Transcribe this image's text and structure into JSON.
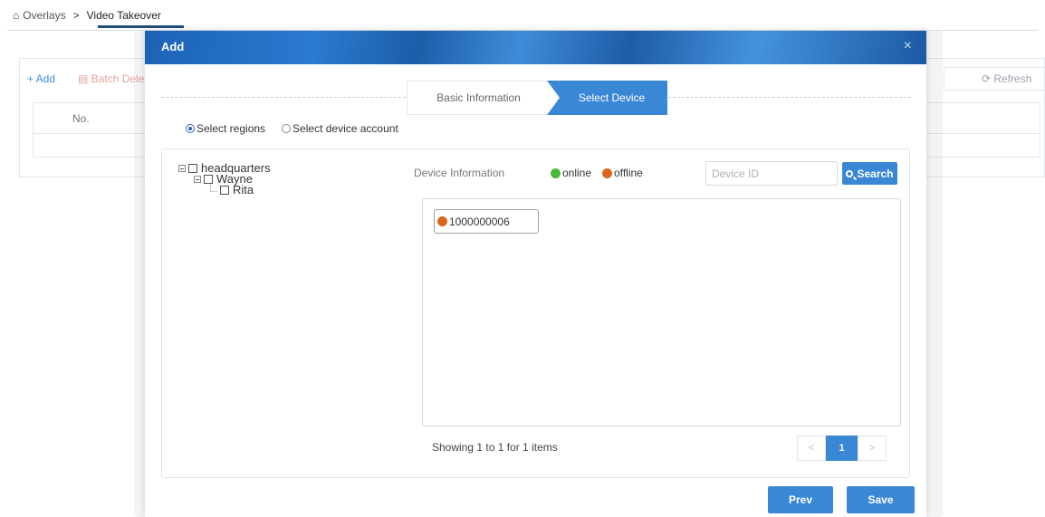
{
  "breadcrumb": {
    "home_icon": "home-icon",
    "items": [
      "Overlays",
      "Video Takeover"
    ],
    "separator": ">"
  },
  "background": {
    "add_label": "+ Add",
    "batch_delete_label": "Batch Dele",
    "refresh_label": "Refresh",
    "table_header_no": "No."
  },
  "modal": {
    "title": "Add",
    "close_symbol": "×",
    "steps": [
      "Basic Information",
      "Select Device"
    ],
    "active_step": "Select Device",
    "radios": [
      {
        "label": "Select regions",
        "selected": true
      },
      {
        "label": "Select device account",
        "selected": false
      }
    ],
    "tree": {
      "root": "headquarters",
      "child": "Wayne",
      "grandchild": "Rita"
    },
    "device_info_label": "Device Information",
    "legend": {
      "online": "online",
      "offline": "offline",
      "online_color": "#4bb83a",
      "offline_color": "#d9661a"
    },
    "search": {
      "placeholder": "Device ID",
      "button_label": "Search"
    },
    "devices": [
      {
        "id": "1000000006",
        "status": "offline"
      }
    ],
    "pagination": {
      "showing_text": "Showing 1 to 1 for 1 items",
      "prev": "<",
      "current_page": "1",
      "next": ">"
    },
    "buttons": {
      "prev": "Prev",
      "save": "Save"
    }
  },
  "colors": {
    "accent": "#3a87d6",
    "header_dark": "#1c5ea8"
  }
}
